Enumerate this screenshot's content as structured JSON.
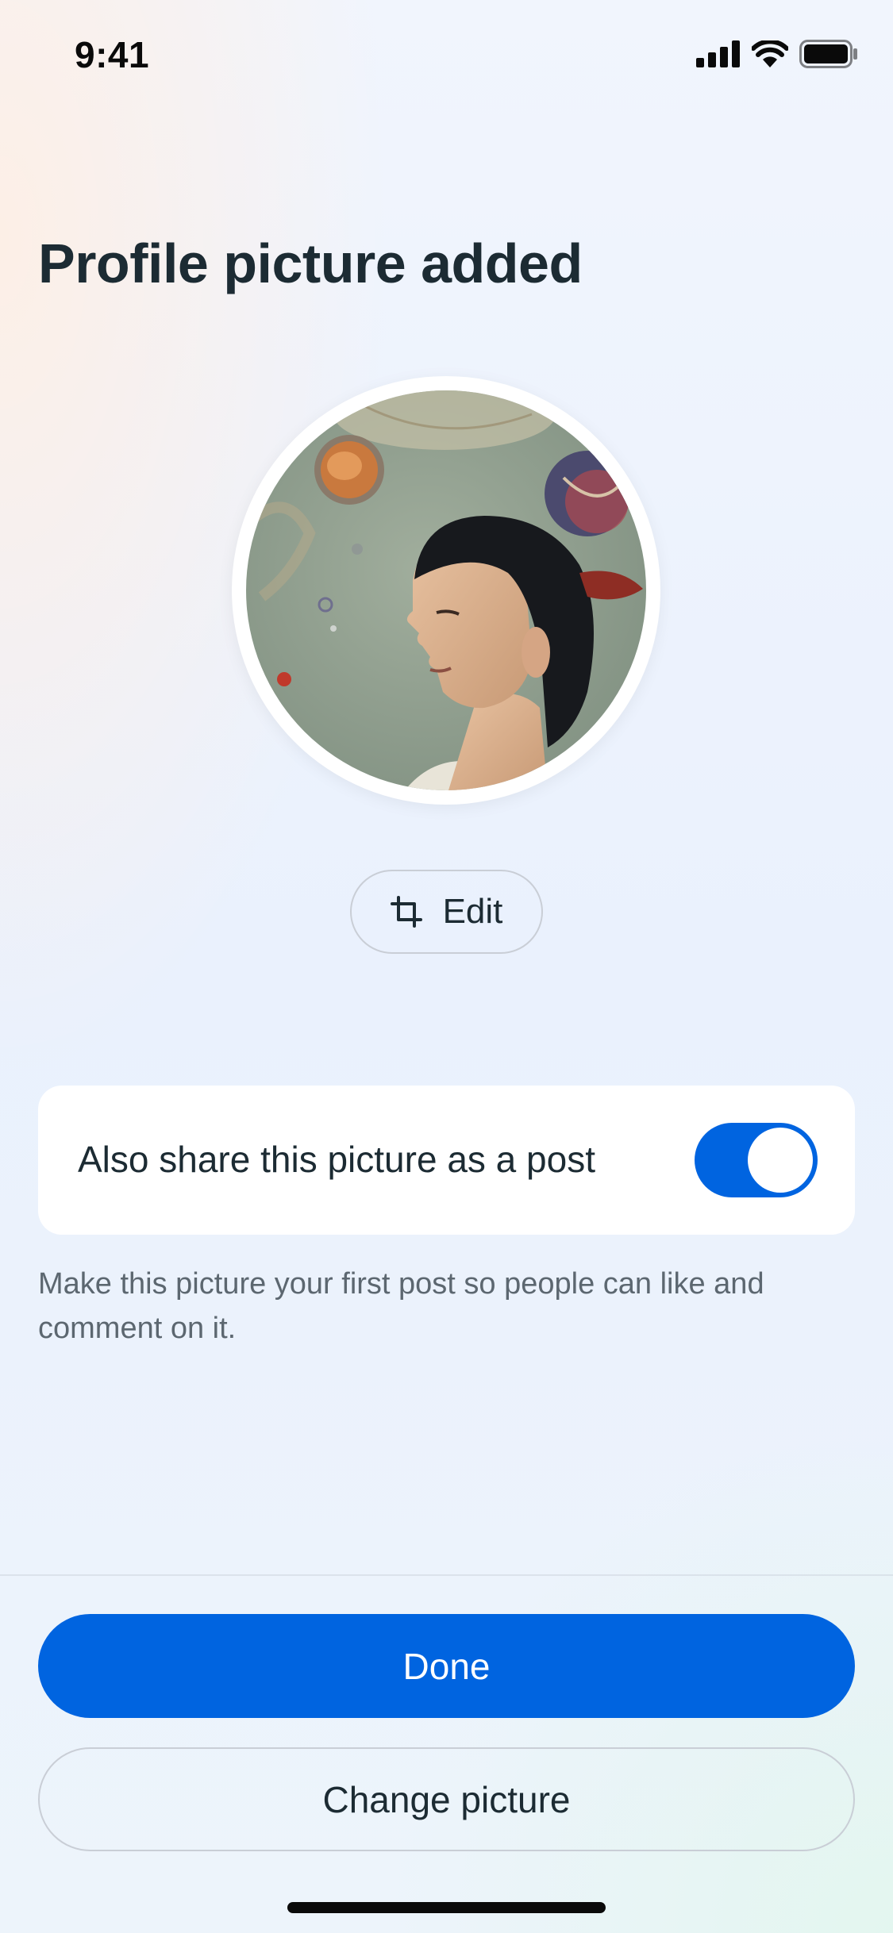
{
  "status_bar": {
    "time": "9:41"
  },
  "header": {
    "title": "Profile picture added"
  },
  "avatar": {
    "description": "profile-photo"
  },
  "edit_button": {
    "label": "Edit",
    "icon": "crop-icon"
  },
  "share_option": {
    "label": "Also share this picture as a post",
    "toggle_on": true,
    "help_text": "Make this picture your first post so people can like and comment on it."
  },
  "actions": {
    "done_label": "Done",
    "change_picture_label": "Change picture"
  },
  "colors": {
    "accent": "#0064e0",
    "text": "#1c2b33",
    "muted": "#5c6770"
  }
}
